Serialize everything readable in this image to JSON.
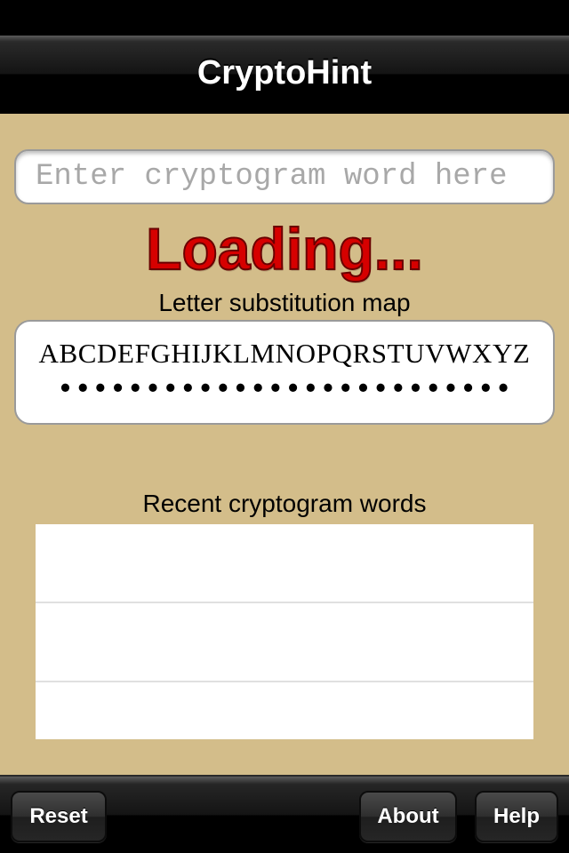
{
  "nav": {
    "title": "CryptoHint"
  },
  "input": {
    "value": "",
    "placeholder": "Enter cryptogram word here"
  },
  "status": {
    "loading_text": "Loading..."
  },
  "map": {
    "label": "Letter substitution map",
    "alphabet": "ABCDEFGHIJKLMNOPQRSTUVWXYZ",
    "substitutions": "••••••••••••••••••••••••••"
  },
  "recent": {
    "label": "Recent cryptogram words",
    "rows": [
      "",
      "",
      ""
    ]
  },
  "toolbar": {
    "reset_label": "Reset",
    "about_label": "About",
    "help_label": "Help"
  },
  "colors": {
    "background": "#d3bd8a",
    "loading_text": "#d60000"
  }
}
